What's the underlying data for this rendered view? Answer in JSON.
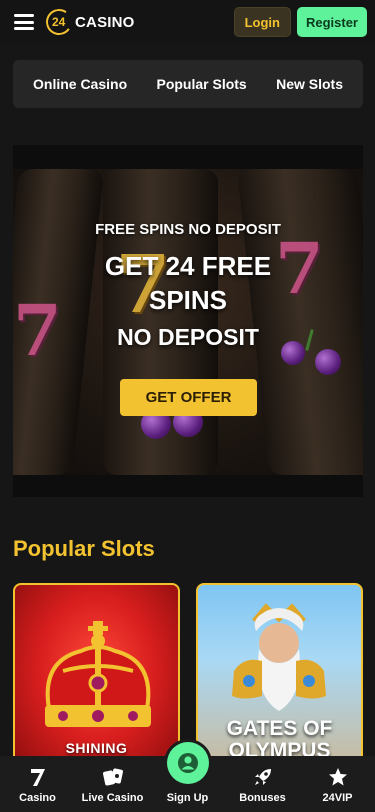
{
  "header": {
    "logo_number": "24",
    "logo_text": "CASINO",
    "login_label": "Login",
    "register_label": "Register"
  },
  "tabs": [
    {
      "label": "Online Casino"
    },
    {
      "label": "Popular Slots"
    },
    {
      "label": "New Slots"
    }
  ],
  "banner": {
    "kicker": "FREE SPINS NO DEPOSIT",
    "headline_line1": "GET 24 FREE",
    "headline_line2": "SPINS",
    "subline": "NO DEPOSIT",
    "cta_label": "GET OFFER"
  },
  "popular_slots": {
    "title": "Popular Slots",
    "cards": [
      {
        "label": "SHINING"
      },
      {
        "label_line1": "GATES OF",
        "label_line2": "OLYMPUS"
      }
    ]
  },
  "bottom_nav": [
    {
      "label": "Casino",
      "icon": "seven-icon"
    },
    {
      "label": "Live Casino",
      "icon": "cards-icon"
    },
    {
      "label": "Sign Up",
      "icon": "user-icon"
    },
    {
      "label": "Bonuses",
      "icon": "rocket-icon"
    },
    {
      "label": "24VIP",
      "icon": "star-icon"
    }
  ],
  "colors": {
    "accent_gold": "#f2c230",
    "accent_green": "#5ef29a",
    "background": "#161616"
  }
}
